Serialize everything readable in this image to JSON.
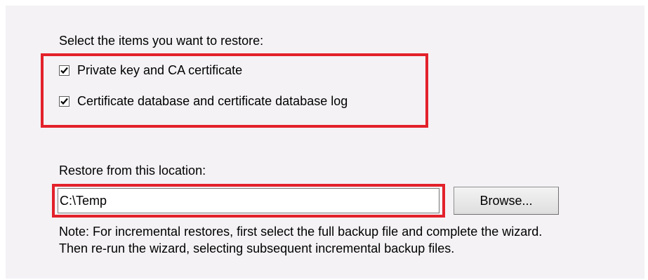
{
  "restore_items": {
    "heading": "Select the items you want to restore:",
    "options": [
      {
        "label": "Private key and CA certificate",
        "checked": true
      },
      {
        "label": "Certificate database and certificate database log",
        "checked": true
      }
    ]
  },
  "location": {
    "label": "Restore from this location:",
    "value": "C:\\Temp",
    "browse_label": "Browse..."
  },
  "note": {
    "line1": "Note: For incremental restores, first select the full backup file and complete the wizard.",
    "line2": "Then re-run the wizard, selecting subsequent incremental backup files."
  },
  "colors": {
    "highlight": "#e3212b",
    "panel_background": "#f4f2f5"
  },
  "icons": {
    "checkmark": "checkmark-icon"
  }
}
